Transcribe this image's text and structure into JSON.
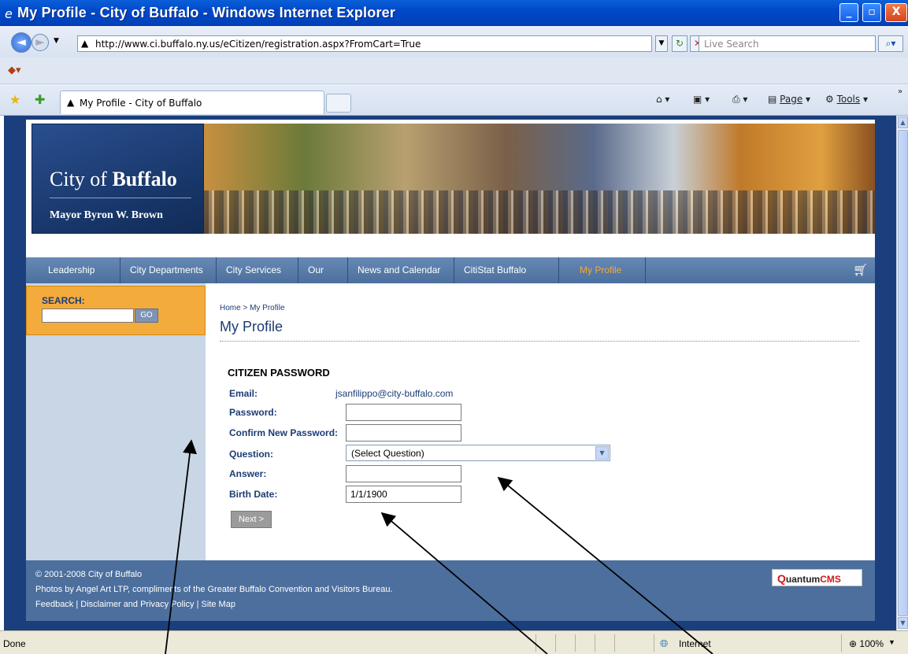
{
  "window": {
    "title": "My Profile - City of Buffalo - Windows Internet Explorer",
    "min_label": "_",
    "max_label": "▫",
    "close_label": "X"
  },
  "addressbar": {
    "url": "http://www.ci.buffalo.ny.us/eCitizen/registration.aspx?FromCart=True",
    "search_placeholder": "Live Search"
  },
  "tabbar": {
    "active_tab": "My Profile - City of Buffalo"
  },
  "toolbar": {
    "page_label": "Page",
    "tools_label": "Tools"
  },
  "site": {
    "city_name_prefix": "City of ",
    "city_name_bold": "Buffalo",
    "mayor": "Mayor Byron W. Brown",
    "nav": [
      "Leadership",
      "City Departments",
      "City Services",
      "Our City",
      "News and Calendar",
      "CitiStat Buffalo",
      "My Profile"
    ],
    "search_label": "SEARCH:",
    "search_go": "GO"
  },
  "main": {
    "breadcrumb": "Home > My Profile",
    "page_title": "My Profile",
    "section_title": "CITIZEN PASSWORD",
    "labels": {
      "email": "Email:",
      "password": "Password:",
      "confirm": "Confirm New Password:",
      "question": "Question:",
      "answer": "Answer:",
      "birth_date": "Birth Date:"
    },
    "email_value": "jsanfilippo@city-buffalo.com",
    "question_selected": "(Select Question)",
    "birth_date_value": "1/1/1900",
    "next_label": "Next >"
  },
  "footer": {
    "copyright": "© 2001-2008 City of Buffalo",
    "photo_credit": "Photos by Angel Art LTP, compliments of the Greater Buffalo Convention and Visitors Bureau.",
    "link_feedback": "Feedback",
    "link_disclaimer": "Disclaimer and Privacy Policy",
    "link_sitemap": "Site Map",
    "separator": " | ",
    "logo_q": "Q",
    "logo_uantum": "uantum",
    "logo_cms": "CMS"
  },
  "statusbar": {
    "status": "Done",
    "zone": "Internet",
    "zoom": "100%"
  },
  "colors": {
    "nav_active": "#f3a93a",
    "nav_bg": "#4c6f9d",
    "search_panel": "#f3ab3b",
    "label_text": "#1c3c74"
  }
}
